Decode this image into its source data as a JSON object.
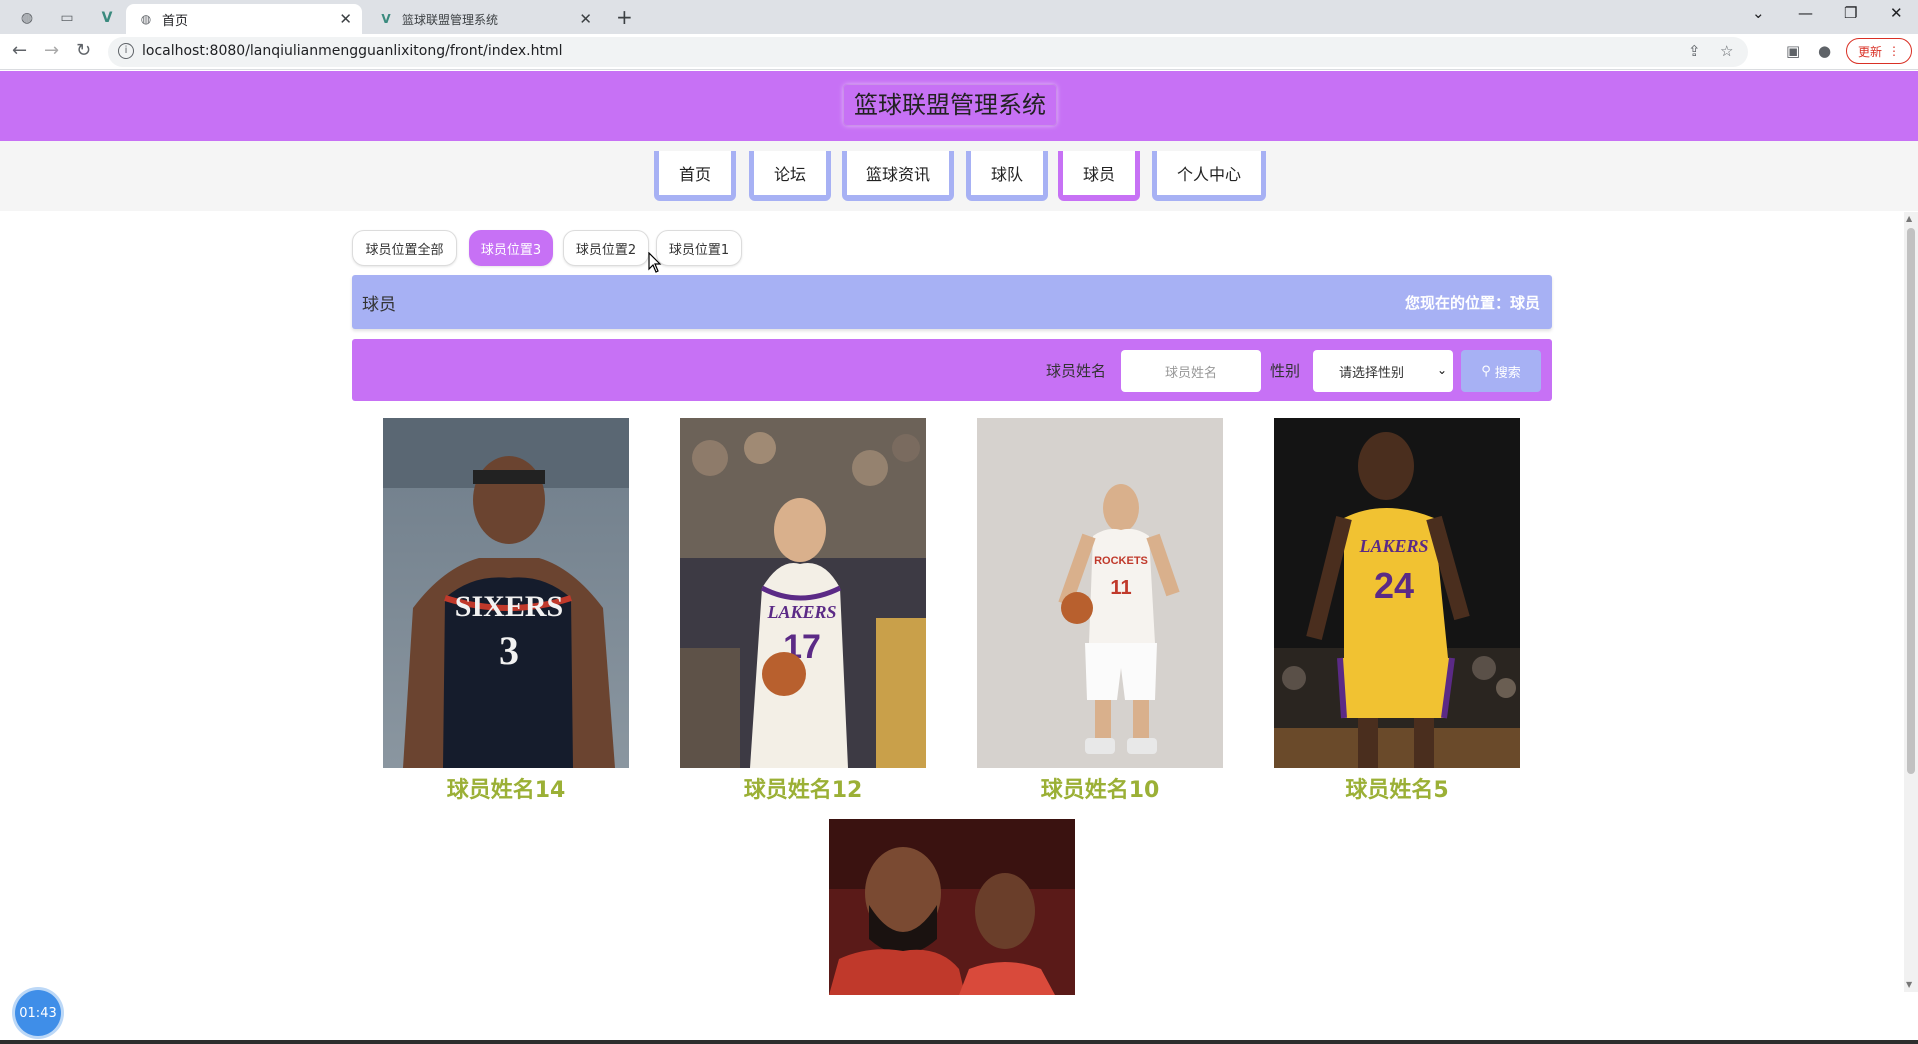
{
  "browser": {
    "tabs": [
      {
        "label": "首页",
        "active": true
      },
      {
        "label": "篮球联盟管理系统",
        "active": false
      }
    ],
    "url": "localhost:8080/lanqiulianmengguanlixitong/front/index.html",
    "update_label": "更新"
  },
  "header": {
    "title": "篮球联盟管理系统",
    "accent_color": "#c771f5",
    "secondary_color": "#a7b1f4"
  },
  "nav": {
    "items": [
      {
        "label": "首页"
      },
      {
        "label": "论坛"
      },
      {
        "label": "篮球资讯"
      },
      {
        "label": "球队"
      },
      {
        "label": "球员"
      },
      {
        "label": "个人中心"
      }
    ],
    "active_index": 4
  },
  "filters": {
    "items": [
      {
        "label": "球员位置全部"
      },
      {
        "label": "球员位置3"
      },
      {
        "label": "球员位置2"
      },
      {
        "label": "球员位置1"
      }
    ],
    "active_index": 1
  },
  "breadcrumb": {
    "title": "球员",
    "location": "您现在的位置：球员"
  },
  "search": {
    "name_label": "球员姓名",
    "name_placeholder": "球员姓名",
    "gender_label": "性别",
    "gender_selected": "请选择性别",
    "button_label": "搜索"
  },
  "players": [
    {
      "name": "球员姓名14",
      "jersey": "3",
      "team": "SIXERS"
    },
    {
      "name": "球员姓名12",
      "jersey": "17",
      "team": "LAKERS"
    },
    {
      "name": "球员姓名10",
      "jersey": "11",
      "team": "ROCKETS"
    },
    {
      "name": "球员姓名5",
      "jersey": "24",
      "team": "LAKERS"
    },
    {
      "name": "",
      "jersey": "",
      "team": ""
    }
  ],
  "timer": "01:43"
}
